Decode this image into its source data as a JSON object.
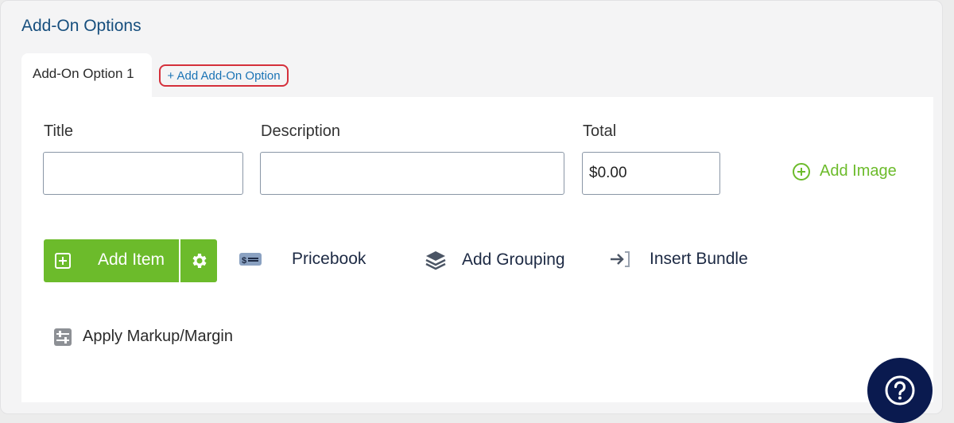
{
  "section": {
    "title": "Add-On Options"
  },
  "tabs": {
    "active_label": "Add-On Option 1",
    "add_label": "+ Add Add-On Option"
  },
  "form": {
    "title_label": "Title",
    "title_value": "",
    "description_label": "Description",
    "description_value": "",
    "total_label": "Total",
    "total_value": "$0.00",
    "add_image_label": "Add Image"
  },
  "toolbar": {
    "add_item_label": "Add Item",
    "pricebook_label": "Pricebook",
    "add_grouping_label": "Add Grouping",
    "insert_bundle_label": "Insert Bundle",
    "apply_markup_label": "Apply Markup/Margin"
  },
  "icons": {
    "add_item": "square-plus-icon",
    "settings": "gear-icon",
    "pricebook": "price-tag-icon",
    "grouping": "layers-icon",
    "bundle": "sign-in-arrow-icon",
    "markup": "sliders-icon",
    "add_image": "circle-plus-icon",
    "help": "question-icon"
  },
  "colors": {
    "accent_green": "#6cbb2b",
    "title_blue": "#174f7e",
    "link_blue": "#1a73b5",
    "highlight_red": "#d5303b",
    "help_navy": "#0a1a4f"
  }
}
